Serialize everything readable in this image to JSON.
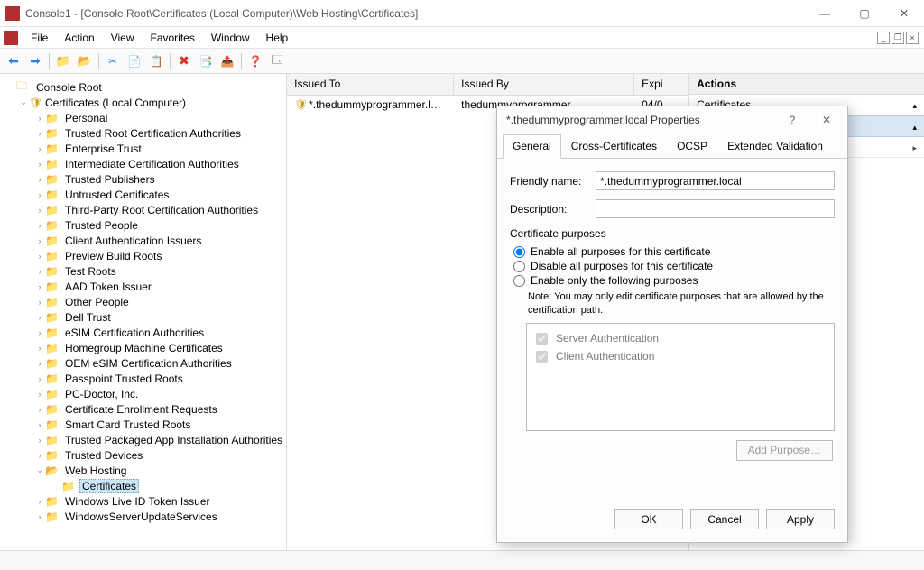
{
  "window": {
    "title": "Console1 - [Console Root\\Certificates (Local Computer)\\Web Hosting\\Certificates]"
  },
  "menu": {
    "file": "File",
    "action": "Action",
    "view": "View",
    "favorites": "Favorites",
    "window_m": "Window",
    "help": "Help"
  },
  "tree": {
    "root": "Console Root",
    "cert_root": "Certificates (Local Computer)",
    "nodes": [
      "Personal",
      "Trusted Root Certification Authorities",
      "Enterprise Trust",
      "Intermediate Certification Authorities",
      "Trusted Publishers",
      "Untrusted Certificates",
      "Third-Party Root Certification Authorities",
      "Trusted People",
      "Client Authentication Issuers",
      "Preview Build Roots",
      "Test Roots",
      "AAD Token Issuer",
      "Other People",
      "Dell Trust",
      "eSIM Certification Authorities",
      "Homegroup Machine Certificates",
      "OEM eSIM Certification Authorities",
      "Passpoint Trusted Roots",
      "PC-Doctor, Inc.",
      "Certificate Enrollment Requests",
      "Smart Card Trusted Roots",
      "Trusted Packaged App Installation Authorities",
      "Trusted Devices"
    ],
    "web_hosting": "Web Hosting",
    "certificates_leaf": "Certificates",
    "tail": [
      "Windows Live ID Token Issuer",
      "WindowsServerUpdateServices"
    ]
  },
  "list": {
    "col_issued_to": "Issued To",
    "col_issued_by": "Issued By",
    "col_expiration": "Expi",
    "row1_to": "*.thedummyprogrammer.local",
    "row1_by": "thedummyprogrammer",
    "row1_exp": "04/0"
  },
  "actions": {
    "header": "Actions",
    "certificates": "Certificates"
  },
  "dialog": {
    "title": "*.thedummyprogrammer.local Properties",
    "tabs": {
      "general": "General",
      "cross": "Cross-Certificates",
      "ocsp": "OCSP",
      "ev": "Extended Validation"
    },
    "friendly_name_label": "Friendly name:",
    "friendly_name_value": "*.thedummyprogrammer.local",
    "description_label": "Description:",
    "description_value": "",
    "purposes_title": "Certificate purposes",
    "r_enable_all": "Enable all purposes for this certificate",
    "r_disable_all": "Disable all purposes for this certificate",
    "r_enable_only": "Enable only the following purposes",
    "note": "Note: You may only edit certificate purposes that are allowed by the certification path.",
    "purpose_server": "Server Authentication",
    "purpose_client": "Client Authentication",
    "add_purpose": "Add Purpose…",
    "ok": "OK",
    "cancel": "Cancel",
    "apply": "Apply"
  }
}
